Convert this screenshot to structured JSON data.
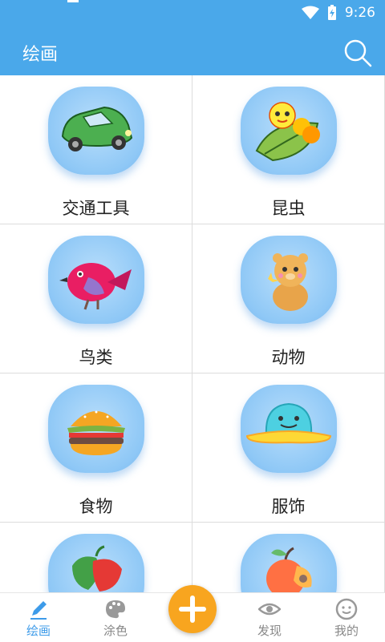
{
  "status": {
    "time": "9:26"
  },
  "appbar": {
    "title": "绘画"
  },
  "categories": [
    {
      "label": "交通工具",
      "icon": "car-icon"
    },
    {
      "label": "昆虫",
      "icon": "caterpillar-icon"
    },
    {
      "label": "鸟类",
      "icon": "bird-icon"
    },
    {
      "label": "动物",
      "icon": "bear-icon"
    },
    {
      "label": "食物",
      "icon": "burger-icon"
    },
    {
      "label": "服饰",
      "icon": "hat-icon"
    },
    {
      "label": "",
      "icon": "pepper-icon"
    },
    {
      "label": "",
      "icon": "apricot-icon"
    }
  ],
  "nav": [
    {
      "label": "绘画",
      "icon": "pencil-icon",
      "active": true
    },
    {
      "label": "涂色",
      "icon": "palette-icon"
    },
    {
      "label": "发现",
      "icon": "eye-icon"
    },
    {
      "label": "我的",
      "icon": "smiley-icon"
    }
  ],
  "colors": {
    "primary": "#4aa8ea",
    "fab": "#f8a51f",
    "active_tab": "#3d9be9"
  }
}
